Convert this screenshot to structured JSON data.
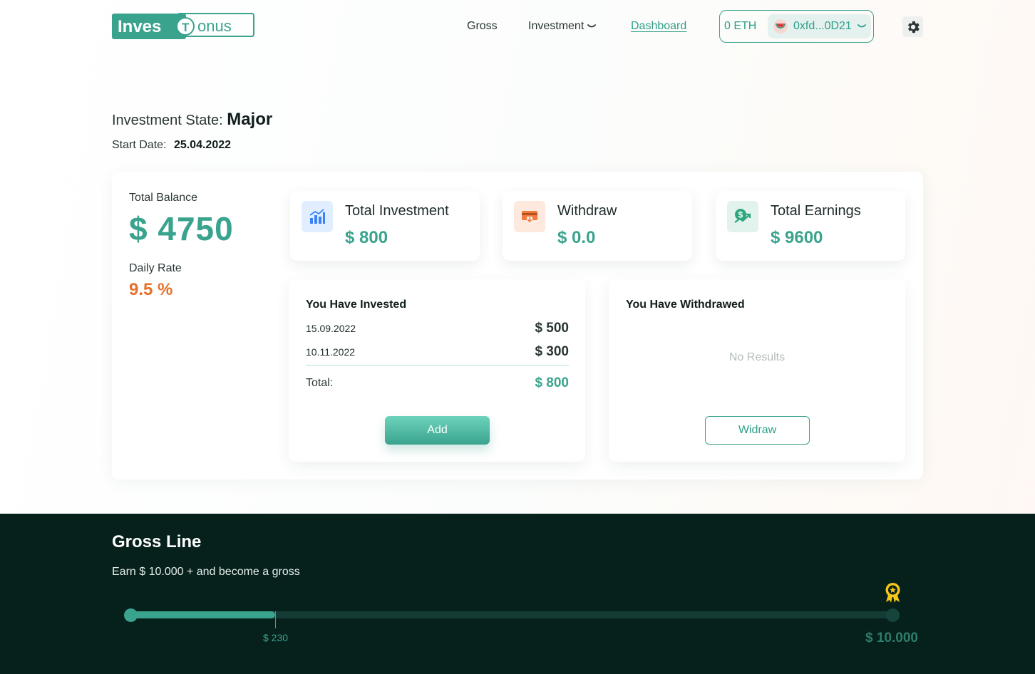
{
  "header": {
    "logo_text_left": "Inves",
    "logo_letter": "T",
    "logo_text_right": "onus",
    "nav": {
      "gross": "Gross",
      "investment": "Investment",
      "dashboard": "Dashboard"
    },
    "wallet": {
      "balance": "0 ETH",
      "address": "0xfd...0D21"
    }
  },
  "investment_state": {
    "label": "Investment State:",
    "value": "Major",
    "start_label": "Start Date:",
    "start_value": "25.04.2022"
  },
  "summary": {
    "total_balance_label": "Total Balance",
    "total_balance_value": "$ 4750",
    "daily_rate_label": "Daily Rate",
    "daily_rate_value": "9.5 %"
  },
  "stats": [
    {
      "title": "Total Investment",
      "value": "$ 800",
      "icon": "chart-icon",
      "bg": "#e1eeff"
    },
    {
      "title": "Withdraw",
      "value": "$ 0.0",
      "icon": "card-withdraw-icon",
      "bg": "#fde9de"
    },
    {
      "title": "Total Earnings",
      "value": "$ 9600",
      "icon": "money-growth-icon",
      "bg": "#e1f3ec"
    }
  ],
  "invested": {
    "title": "You Have Invested",
    "rows": [
      {
        "date": "15.09.2022",
        "amount": "$ 500"
      },
      {
        "date": "10.11.2022",
        "amount": "$ 300"
      }
    ],
    "total_label": "Total:",
    "total_value": "$ 800",
    "button": "Add"
  },
  "withdrawed": {
    "title": "You Have Withdrawed",
    "empty": "No Results",
    "button": "Widraw"
  },
  "gross_line": {
    "title": "Gross Line",
    "subtitle": "Earn $ 10.000 + and become a gross",
    "current_label": "$ 230",
    "goal_label": "$ 10.000",
    "progress_fraction": 0.19
  },
  "colors": {
    "accent": "#3aa38e",
    "orange": "#e8702a",
    "dark": "#06201c"
  }
}
